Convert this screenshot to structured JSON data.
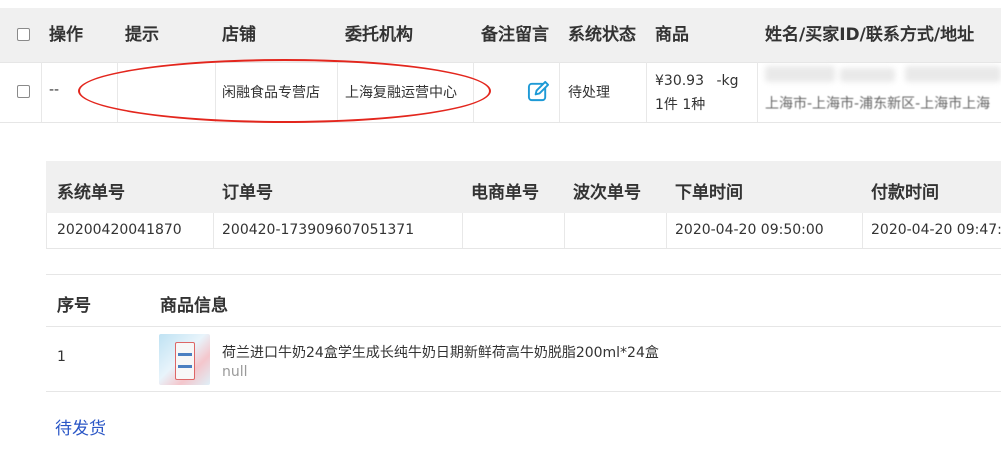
{
  "main_table": {
    "headers": [
      "操作",
      "提示",
      "店铺",
      "委托机构",
      "备注留言",
      "系统状态",
      "商品",
      "姓名/买家ID/联系方式/地址"
    ],
    "row": {
      "operation": "--",
      "tip": "",
      "shop": "闲融食品专营店",
      "agency": "上海复融运营中心",
      "remark_icon": "edit-icon",
      "status": "待处理",
      "goods_price": "¥30.93",
      "goods_weight": "-kg",
      "goods_count": "1件 1种",
      "address": "上海市-上海市-浦东新区-上海市上海"
    }
  },
  "order_table": {
    "headers": [
      "系统单号",
      "订单号",
      "电商单号",
      "波次单号",
      "下单时间",
      "付款时间"
    ],
    "row": {
      "system_no": "20200420041870",
      "order_no": "200420-173909607051371",
      "ecommerce_no": "",
      "wave_no": "",
      "order_time": "2020-04-20 09:50:00",
      "pay_time": "2020-04-20 09:47:"
    }
  },
  "goods_table": {
    "headers": [
      "序号",
      "商品信息"
    ],
    "row": {
      "index": "1",
      "name": "荷兰进口牛奶24盒学生成长纯牛奶日期新鲜荷高牛奶脱脂200ml*24盒",
      "sub": "null"
    }
  },
  "footer_link": "待发货",
  "colors": {
    "header_bg": "#f0f0f0",
    "annotation_red": "#e3261d",
    "link_blue": "#2a56c6",
    "icon_blue": "#1e9ad6"
  }
}
